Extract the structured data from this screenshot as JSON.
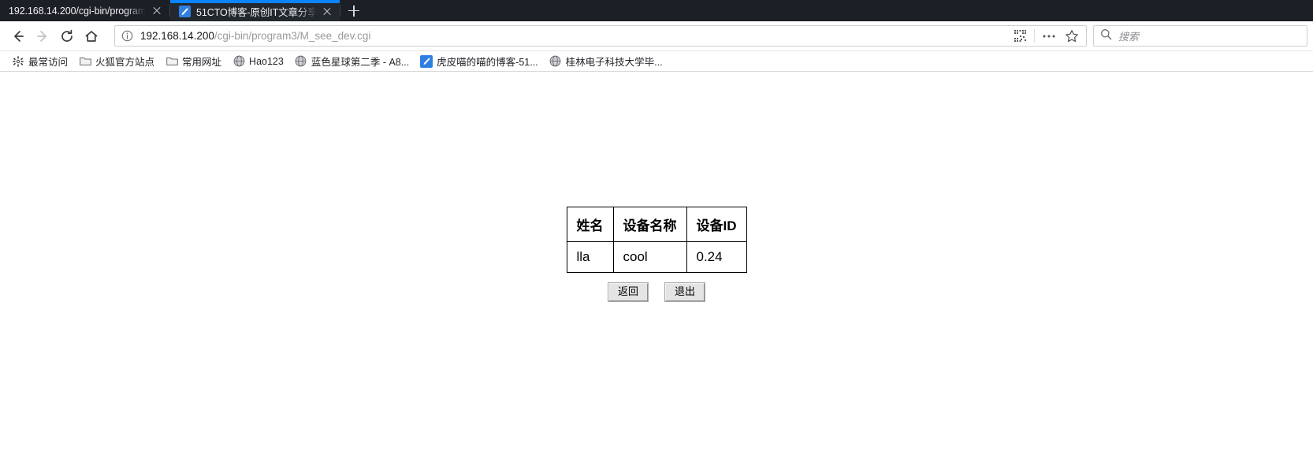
{
  "browser": {
    "tabs": [
      {
        "title": "192.168.14.200/cgi-bin/program",
        "active": false,
        "favicon": "none"
      },
      {
        "title": "51CTO博客-原创IT文章分享平",
        "active": true,
        "favicon": "blue-pen-icon"
      }
    ],
    "new_tab_label": "+",
    "nav": {
      "back": "back-arrow",
      "forward": "forward-arrow",
      "reload": "reload-arrow",
      "home": "home-icon"
    },
    "urlbar": {
      "info_icon": "info-circle-icon",
      "host": "192.168.14.200",
      "path": "/cgi-bin/program3/M_see_dev.cgi",
      "full_url": "192.168.14.200/cgi-bin/program3/M_see_dev.cgi",
      "qr_icon": "qr-code-icon",
      "more_icon": "ellipsis-icon",
      "bookmark_icon": "star-icon"
    },
    "search": {
      "icon": "search-icon",
      "placeholder": "搜索"
    },
    "bookmarks": [
      {
        "label": "最常访问",
        "icon": "gear-icon"
      },
      {
        "label": "火狐官方站点",
        "icon": "folder-icon"
      },
      {
        "label": "常用网址",
        "icon": "folder-icon"
      },
      {
        "label": "Hao123",
        "icon": "globe-icon"
      },
      {
        "label": "蓝色星球第二季 - A8...",
        "icon": "globe-icon"
      },
      {
        "label": "虎皮喵的喵的博客-51...",
        "icon": "blue-pen-icon"
      },
      {
        "label": "桂林电子科技大学毕...",
        "icon": "globe-icon"
      }
    ]
  },
  "page": {
    "table": {
      "headers": [
        "姓名",
        "设备名称",
        "设备ID"
      ],
      "rows": [
        [
          "lla",
          "cool",
          "0.24"
        ]
      ]
    },
    "buttons": {
      "back": "返回",
      "exit": "退出"
    }
  },
  "colors": {
    "tabstrip_bg": "#1c2026",
    "active_tab_bg": "#23282e",
    "accent": "#0a84ff",
    "favicon_blue": "#2f7fe0",
    "page_bg": "#ffffff",
    "table_border": "#000000",
    "button_face": "#e4e4e4"
  }
}
